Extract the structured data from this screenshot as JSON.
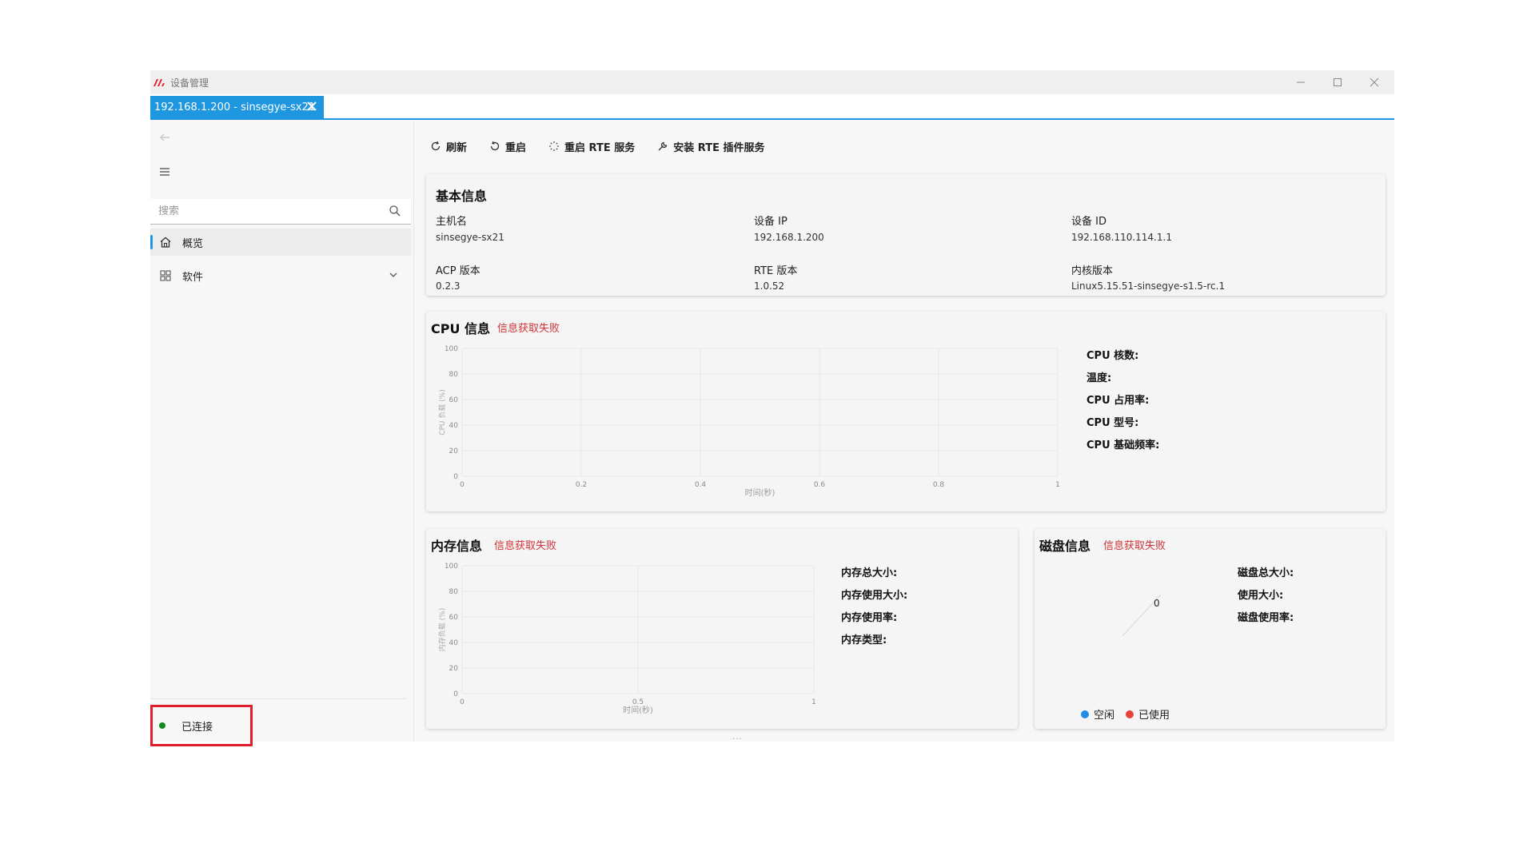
{
  "window": {
    "title": "设备管理"
  },
  "tab": {
    "label": "192.168.1.200 - sinsegye-sx21"
  },
  "sidebar": {
    "search_placeholder": "搜索",
    "items": [
      {
        "label": "概览",
        "icon": "home-icon"
      },
      {
        "label": "软件",
        "icon": "apps-icon"
      }
    ],
    "status": {
      "label": "已连接",
      "color": "#138a20"
    }
  },
  "toolbar": {
    "refresh": "刷新",
    "restart": "重启",
    "restart_rte": "重启 RTE 服务",
    "install_rte": "安装 RTE 插件服务"
  },
  "basic": {
    "title": "基本信息",
    "fields": [
      {
        "label": "主机名",
        "value": "sinsegye-sx21"
      },
      {
        "label": "设备 IP",
        "value": "192.168.1.200"
      },
      {
        "label": "设备 ID",
        "value": "192.168.110.114.1.1"
      },
      {
        "label": "ACP 版本",
        "value": "0.2.3"
      },
      {
        "label": "RTE 版本",
        "value": "1.0.52"
      },
      {
        "label": "内核版本",
        "value": "Linux5.15.51-sinsegye-s1.5-rc.1"
      }
    ]
  },
  "cpu": {
    "title": "CPU 信息",
    "error": "信息获取失败",
    "stats": [
      "CPU 核数:",
      "温度:",
      "CPU 占用率:",
      "CPU 型号:",
      "CPU 基础频率:"
    ]
  },
  "memory": {
    "title": "内存信息",
    "error": "信息获取失败",
    "stats": [
      "内存总大小:",
      "内存使用大小:",
      "内存使用率:",
      "内存类型:"
    ]
  },
  "disk": {
    "title": "磁盘信息",
    "error": "信息获取失败",
    "stats": [
      "磁盘总大小:",
      "使用大小:",
      "磁盘使用率:"
    ],
    "center_value": "0",
    "legend": [
      {
        "label": "空闲",
        "color": "#1f8ce6"
      },
      {
        "label": "已使用",
        "color": "#e8413c"
      }
    ]
  },
  "chart_data": [
    {
      "type": "line",
      "title": "CPU 信息",
      "xlabel": "时间(秒)",
      "ylabel": "CPU 负载 (%)",
      "x_ticks": [
        "0",
        "0.2",
        "0.4",
        "0.6",
        "0.8",
        "1"
      ],
      "y_ticks": [
        "0",
        "20",
        "40",
        "60",
        "80",
        "100"
      ],
      "xlim": [
        0,
        1
      ],
      "ylim": [
        0,
        100
      ],
      "grid": true,
      "series": []
    },
    {
      "type": "line",
      "title": "内存信息",
      "xlabel": "时间(秒)",
      "ylabel": "内存负载 (%)",
      "x_ticks": [
        "0",
        "0.5",
        "1"
      ],
      "y_ticks": [
        "0",
        "20",
        "40",
        "60",
        "80",
        "100"
      ],
      "xlim": [
        0,
        1
      ],
      "ylim": [
        0,
        100
      ],
      "grid": true,
      "series": []
    },
    {
      "type": "pie",
      "title": "磁盘信息",
      "categories": [
        "空闲",
        "已使用"
      ],
      "values": [
        0,
        0
      ]
    }
  ]
}
